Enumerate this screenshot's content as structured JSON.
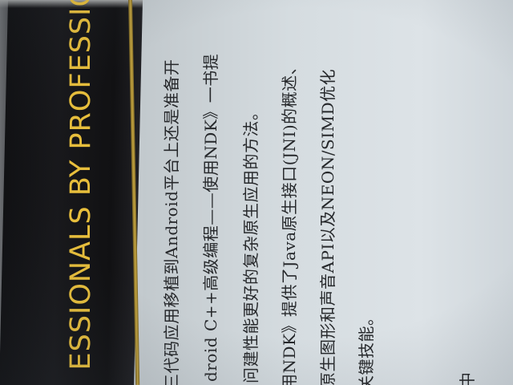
{
  "book": {
    "spine_tagline": "ESSIONALS BY PROFESSIO",
    "body_lines": [
      "三代码应用移植到Android平台上还是准备开",
      "droid C++高级编程——使用NDK》一书提",
      "问建性能更好的复杂原生应用的方法。",
      "用NDK》提供了Java原生接口(JNI)的概述、",
      "原生图形和声音API以及NEON/SIMD优化",
      "关键技能。",
      "中"
    ]
  },
  "colors": {
    "spine": "#141416",
    "tagline": "#e7be3c",
    "page": "#d5dce0",
    "text": "#26282b"
  }
}
